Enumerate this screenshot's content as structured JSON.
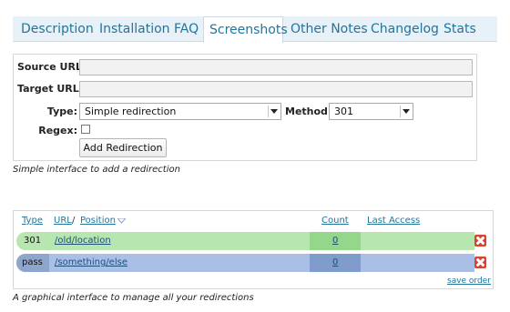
{
  "tabs": [
    "Description",
    "Installation",
    "FAQ",
    "Screenshots",
    "Other Notes",
    "Changelog",
    "Stats"
  ],
  "active_tab": "Screenshots",
  "form": {
    "source_url_label": "Source URL:",
    "source_url_value": "",
    "target_url_label": "Target URL:",
    "target_url_value": "",
    "type_label": "Type:",
    "type_value": "Simple redirection",
    "method_label": "Method:",
    "method_value": "301",
    "regex_label": "Regex:",
    "regex_checked": false,
    "add_button": "Add Redirection",
    "caption": "Simple interface to add a redirection"
  },
  "list": {
    "headers": {
      "type": "Type",
      "url": "URL",
      "separator": "/",
      "position": "Position",
      "count": "Count",
      "last_access": "Last Access"
    },
    "rows": [
      {
        "type": "301",
        "url": "/old/location",
        "count": "0",
        "color": "#b8e6b0",
        "count_color": "#94d68a"
      },
      {
        "type": "pass",
        "url": "/something/else",
        "count": "0",
        "color": "#a9bfe6",
        "count_color": "#7f9ccd"
      }
    ],
    "save_order": "save order",
    "caption": "A graphical interface to manage all your redirections"
  }
}
